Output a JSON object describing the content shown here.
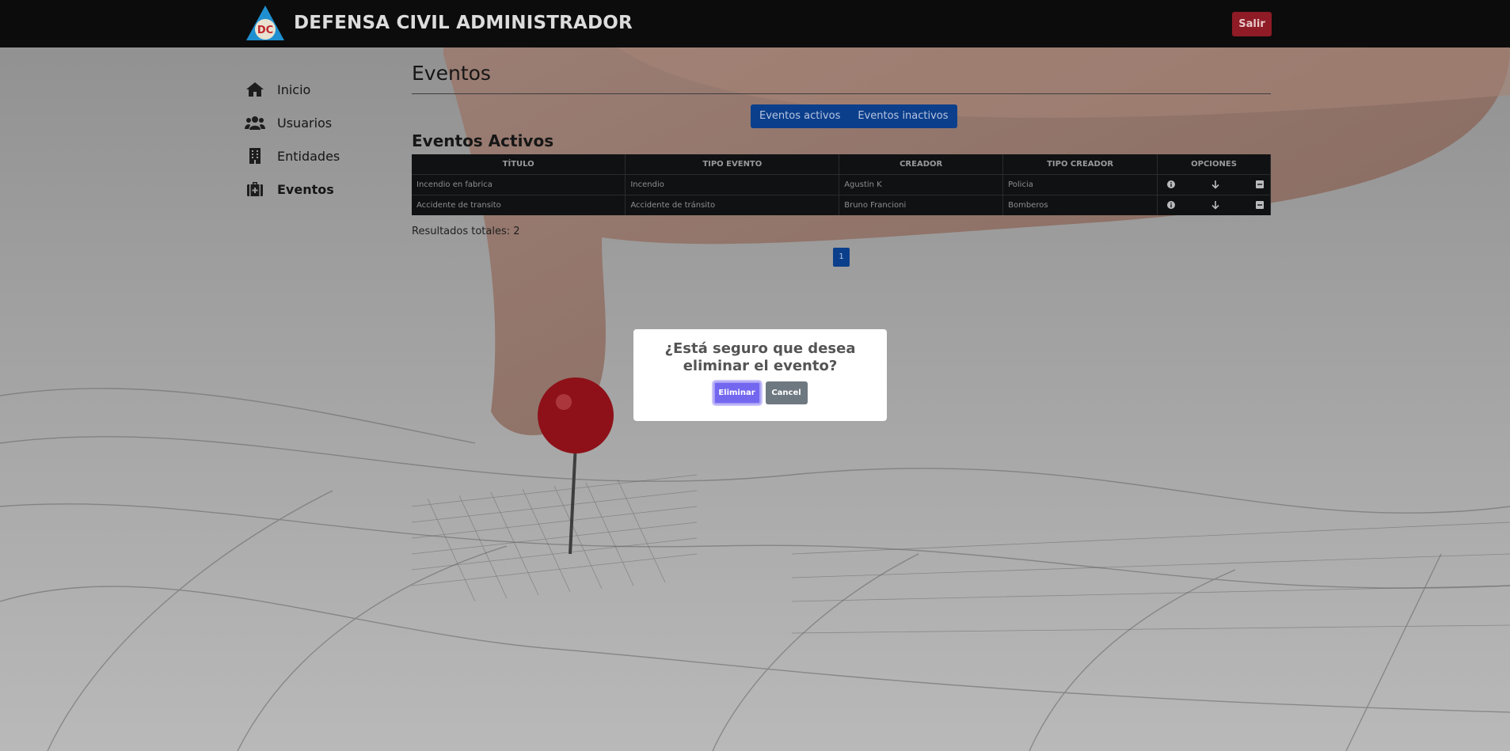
{
  "header": {
    "logo_text": "DC",
    "title": "DEFENSA CIVIL ADMINISTRADOR",
    "logout_label": "Salir"
  },
  "sidebar": {
    "items": [
      {
        "label": "Inicio",
        "icon": "home-icon"
      },
      {
        "label": "Usuarios",
        "icon": "users-icon"
      },
      {
        "label": "Entidades",
        "icon": "building-icon"
      },
      {
        "label": "Eventos",
        "icon": "medkit-icon",
        "active": true
      }
    ]
  },
  "main": {
    "title": "Eventos",
    "tabs": [
      {
        "label": "Eventos activos"
      },
      {
        "label": "Eventos inactivos"
      }
    ],
    "section_title": "Eventos Activos",
    "table": {
      "headers": [
        "TÍTULO",
        "TIPO EVENTO",
        "CREADOR",
        "TIPO CREADOR",
        "OPCIONES"
      ],
      "rows": [
        {
          "titulo": "Incendio en fabrica",
          "tipo_evento": "Incendio",
          "creador": "Agustin K",
          "tipo_creador": "Policia"
        },
        {
          "titulo": "Accidente de transito",
          "tipo_evento": "Accidente de tránsito",
          "creador": "Bruno Francioni",
          "tipo_creador": "Bomberos"
        }
      ],
      "option_icons": [
        "info-icon",
        "arrow-down-icon",
        "minus-square-icon"
      ]
    },
    "results_text": "Resultados totales: 2",
    "pagination": {
      "current_page": "1"
    }
  },
  "modal": {
    "message": "¿Está seguro que desea eliminar el evento?",
    "confirm_label": "Eliminar",
    "cancel_label": "Cancel"
  },
  "colors": {
    "header_bg": "#0c0c0c",
    "logout_btn": "#8e1b26",
    "primary_btn": "#0c3f8b",
    "confirm_btn": "#7367f0",
    "cancel_btn": "#6e7881"
  }
}
